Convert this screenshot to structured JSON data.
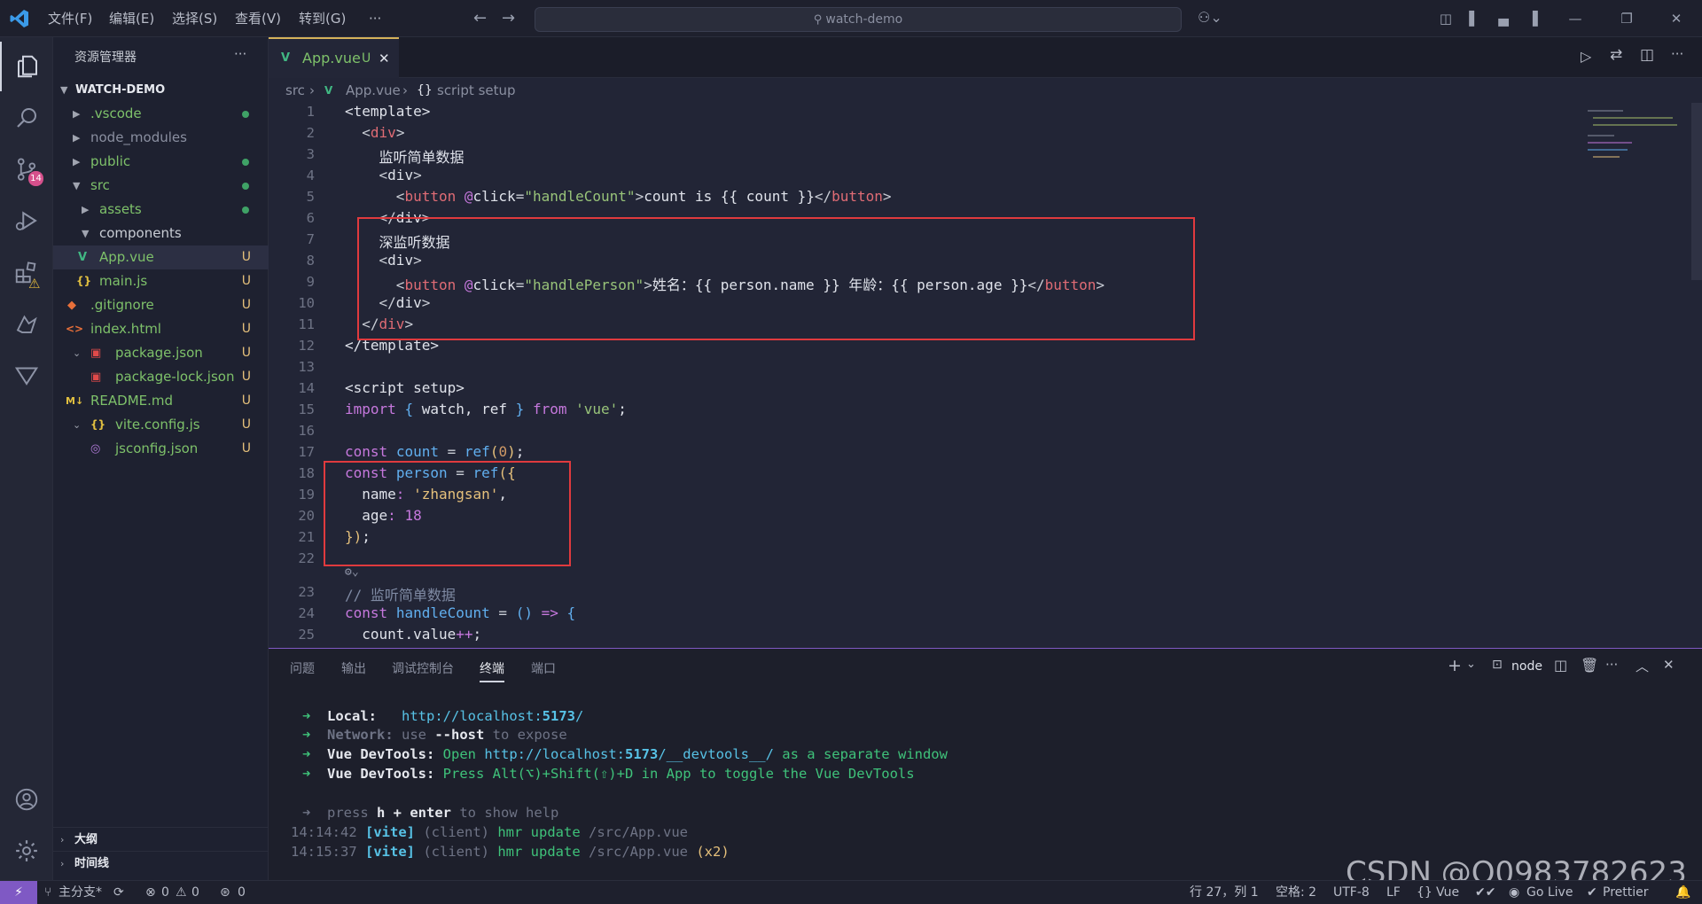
{
  "titlebar": {
    "menus": [
      "文件(F)",
      "编辑(E)",
      "选择(S)",
      "查看(V)",
      "转到(G)",
      "···"
    ],
    "search": "watch-demo"
  },
  "activity": {
    "scm_badge": "14"
  },
  "sidebar": {
    "title": "资源管理器",
    "more": "···",
    "root": "WATCH-DEMO",
    "items": [
      {
        "label": ".vscode",
        "status": "dot"
      },
      {
        "label": "node_modules",
        "status": ""
      },
      {
        "label": "public",
        "status": "dot"
      },
      {
        "label": "src",
        "status": "dot"
      },
      {
        "label": "assets",
        "status": "dot"
      },
      {
        "label": "components",
        "status": ""
      },
      {
        "label": "App.vue",
        "status": "U"
      },
      {
        "label": "main.js",
        "status": "U"
      },
      {
        "label": ".gitignore",
        "status": "U"
      },
      {
        "label": "index.html",
        "status": "U"
      },
      {
        "label": "package.json",
        "status": "U"
      },
      {
        "label": "package-lock.json",
        "status": "U"
      },
      {
        "label": "README.md",
        "status": "U"
      },
      {
        "label": "vite.config.js",
        "status": "U"
      },
      {
        "label": "jsconfig.json",
        "status": "U"
      }
    ],
    "outline": "大纲",
    "timeline": "时间线"
  },
  "editor": {
    "tab_label": "App.vue",
    "tab_status": "U",
    "breadcrumb": [
      "src",
      "App.vue",
      "script setup"
    ],
    "lines": [
      "1",
      "2",
      "3",
      "4",
      "5",
      "6",
      "7",
      "8",
      "9",
      "10",
      "11",
      "12",
      "13",
      "14",
      "15",
      "16",
      "17",
      "18",
      "19",
      "20",
      "21",
      "22",
      "23",
      "24",
      "25"
    ]
  },
  "panel": {
    "tabs": [
      "问题",
      "输出",
      "调试控制台",
      "终端",
      "端口"
    ],
    "active_tab": "终端",
    "shell": "node",
    "local_label": "Local:",
    "local_url": "http://localhost:",
    "local_port": "5173",
    "network_label": "Network:",
    "network_text": " use ",
    "network_flag": "--host",
    "network_tail": " to expose",
    "devtools_label": "Vue DevTools:",
    "devtools_1a": " Open ",
    "devtools_1b": "http://localhost:",
    "devtools_1c": "5173",
    "devtools_1d": "/__devtools__/",
    "devtools_1e": " as a separate window",
    "devtools_2": " Press Alt(⌥)+Shift(⇧)+D in App to toggle the Vue DevTools",
    "help_a": "press ",
    "help_b": "h + enter",
    "help_c": " to show help",
    "log1_time": "14:14:42",
    "log2_time": "14:15:37",
    "vite_tag": "[vite]",
    "client_tag": "(client)",
    "hmr_text": "hmr update",
    "hmr_path": "/src/App.vue",
    "x2": "(x2)"
  },
  "status": {
    "branch": "主分支*",
    "errors": "0",
    "warnings": "0",
    "ports": "0",
    "position": "行 27，列 1",
    "spaces": "空格: 2",
    "encoding": "UTF-8",
    "eol": "LF",
    "language": "Vue",
    "golive": "Go Live",
    "prettier": "Prettier"
  },
  "watermark": "CSDN @Q0983782623"
}
